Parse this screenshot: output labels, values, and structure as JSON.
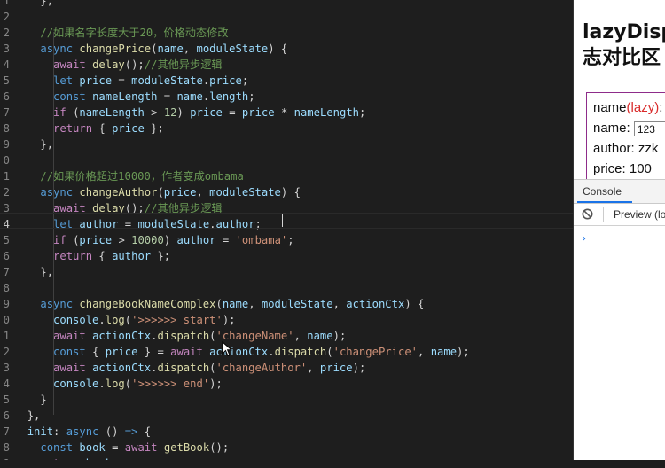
{
  "editor": {
    "lines": [
      {
        "num": "1",
        "html": "    <span class='p'>},</span>"
      },
      {
        "num": "2",
        "html": "  "
      },
      {
        "num": "2",
        "html": "    <span class='c'>//如果名字长度大于20，价格动态修改</span>"
      },
      {
        "num": "3",
        "html": "    <span class='k'>async</span> <span class='f'>changePrice</span><span class='p'>(</span><span class='v'>name</span><span class='p'>, </span><span class='v'>moduleState</span><span class='p'>) {</span>"
      },
      {
        "num": "4",
        "html": "      <span class='kc'>await</span> <span class='f'>delay</span><span class='p'>();</span><span class='c'>//其他异步逻辑</span>"
      },
      {
        "num": "5",
        "html": "      <span class='k'>let</span> <span class='v'>price</span> <span class='o'>=</span> <span class='v'>moduleState</span><span class='p'>.</span><span class='v'>price</span><span class='p'>;</span>"
      },
      {
        "num": "6",
        "html": "      <span class='k'>const</span> <span class='v'>nameLength</span> <span class='o'>=</span> <span class='v'>name</span><span class='p'>.</span><span class='v'>length</span><span class='p'>;</span>"
      },
      {
        "num": "7",
        "html": "      <span class='kc'>if</span> <span class='p'>(</span><span class='v'>nameLength</span> <span class='o'>&gt;</span> <span class='n'>12</span><span class='p'>)</span> <span class='v'>price</span> <span class='o'>=</span> <span class='v'>price</span> <span class='o'>*</span> <span class='v'>nameLength</span><span class='p'>;</span>"
      },
      {
        "num": "8",
        "html": "      <span class='kc'>return</span> <span class='p'>{ </span><span class='v'>price</span><span class='p'> };</span>"
      },
      {
        "num": "9",
        "html": "    <span class='p'>},</span>"
      },
      {
        "num": "0",
        "html": "  "
      },
      {
        "num": "1",
        "html": "    <span class='c'>//如果价格超过10000，作者变成ombama</span>"
      },
      {
        "num": "2",
        "html": "    <span class='k'>async</span> <span class='f'>changeAuthor</span><span class='p'>(</span><span class='v'>price</span><span class='p'>, </span><span class='v'>moduleState</span><span class='p'>) {</span>"
      },
      {
        "num": "3",
        "html": "      <span class='kc'>await</span> <span class='f'>delay</span><span class='p'>();</span><span class='c'>//其他异步逻辑</span>"
      },
      {
        "num": "4",
        "html": "      <span class='k'>let</span> <span class='v'>author</span> <span class='o'>=</span> <span class='v'>moduleState</span><span class='p'>.</span><span class='v'>author</span><span class='p'>;</span>"
      },
      {
        "num": "5",
        "html": "      <span class='kc'>if</span> <span class='p'>(</span><span class='v'>price</span> <span class='o'>&gt;</span> <span class='n'>10000</span><span class='p'>)</span> <span class='v'>author</span> <span class='o'>=</span> <span class='s'>'ombama'</span><span class='p'>;</span>"
      },
      {
        "num": "6",
        "html": "      <span class='kc'>return</span> <span class='p'>{ </span><span class='v'>author</span><span class='p'> };</span>"
      },
      {
        "num": "7",
        "html": "    <span class='p'>},</span>"
      },
      {
        "num": "8",
        "html": "  "
      },
      {
        "num": "9",
        "html": "    <span class='k'>async</span> <span class='f'>changeBookNameComplex</span><span class='p'>(</span><span class='v'>name</span><span class='p'>, </span><span class='v'>moduleState</span><span class='p'>, </span><span class='v'>actionCtx</span><span class='p'>) {</span>"
      },
      {
        "num": "0",
        "html": "      <span class='v'>console</span><span class='p'>.</span><span class='f'>log</span><span class='p'>(</span><span class='s'>'&gt;&gt;&gt;&gt;&gt;&gt; start'</span><span class='p'>);</span>"
      },
      {
        "num": "1",
        "html": "      <span class='kc'>await</span> <span class='v'>actionCtx</span><span class='p'>.</span><span class='f'>dispatch</span><span class='p'>(</span><span class='s'>'changeName'</span><span class='p'>, </span><span class='v'>name</span><span class='p'>);</span>"
      },
      {
        "num": "2",
        "html": "      <span class='k'>const</span> <span class='p'>{ </span><span class='v'>price</span><span class='p'> } </span><span class='o'>=</span> <span class='kc'>await</span> <span class='v'>actionCtx</span><span class='p'>.</span><span class='f'>dispatch</span><span class='p'>(</span><span class='s'>'changePrice'</span><span class='p'>, </span><span class='v'>name</span><span class='p'>);</span>"
      },
      {
        "num": "3",
        "html": "      <span class='kc'>await</span> <span class='v'>actionCtx</span><span class='p'>.</span><span class='f'>dispatch</span><span class='p'>(</span><span class='s'>'changeAuthor'</span><span class='p'>, </span><span class='v'>price</span><span class='p'>);</span>"
      },
      {
        "num": "4",
        "html": "      <span class='v'>console</span><span class='p'>.</span><span class='f'>log</span><span class='p'>(</span><span class='s'>'&gt;&gt;&gt;&gt;&gt;&gt; end'</span><span class='p'>);</span>"
      },
      {
        "num": "5",
        "html": "    <span class='p'>}</span>"
      },
      {
        "num": "6",
        "html": "  <span class='p'>},</span>"
      },
      {
        "num": "7",
        "html": "  <span class='v'>init</span><span class='p'>: </span><span class='k'>async</span> <span class='p'>() </span><span class='k'>=&gt;</span><span class='p'> {</span>"
      },
      {
        "num": "8",
        "html": "    <span class='k'>const</span> <span class='v'>book</span> <span class='o'>=</span> <span class='kc'>await</span> <span class='f'>getBook</span><span class='p'>();</span>"
      },
      {
        "num": "9",
        "html": "    <span class='kc'>return</span> <span class='v'>book</span><span class='p'>;</span>"
      }
    ]
  },
  "browser": {
    "title_line1": "lazyDisp",
    "title_line2": "志对比区",
    "panel": {
      "name_lazy_prefix": "name",
      "name_lazy_label": "(lazy)",
      "name_lazy_suffix": ":",
      "name_label": "name:",
      "name_input_value": "123",
      "author": "author: zzk",
      "price": "price: 100"
    },
    "console_tab": "Console",
    "preview_label": "Preview (lo",
    "prompt_glyph": "›"
  },
  "colors": {
    "editor_bg": "#1e1e1e",
    "keyword": "#569cd6",
    "control": "#c586c0",
    "function": "#dcdcaa",
    "variable": "#9cdcfe",
    "string": "#ce9178",
    "comment": "#6a9955",
    "number": "#b5cea8",
    "lazy_red": "#d92b2b",
    "panel_border": "#8e2c8a",
    "accent_blue": "#1a73e8"
  }
}
